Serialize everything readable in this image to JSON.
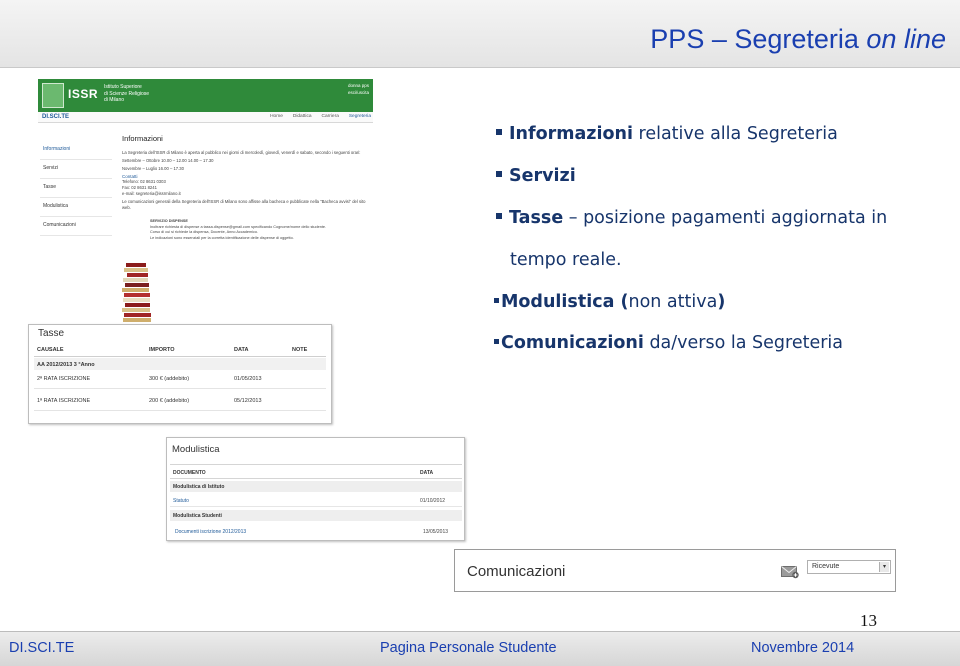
{
  "header": {
    "title_prefix": "PPS – Segreteria ",
    "title_emphasis": "on line"
  },
  "portal": {
    "logo_text": "ISSR",
    "logo_lines": [
      "Istituto Superiore",
      "di Scienze Religiose",
      "di Milano"
    ],
    "user_line1": "donna pps",
    "user_line2": "esci/uscita",
    "brand": "DI.SCI.TE",
    "nav": [
      "Home",
      "Didattica",
      "Carriera",
      "Segreteria"
    ],
    "sidebar": [
      "Informazioni",
      "Servizi",
      "Tasse",
      "Modulistica",
      "Comunicazioni"
    ],
    "main_title": "Informazioni",
    "paragraph": "La Segreteria dell'ISSR di Milano è aperta al pubblico nei giorni di mercoledì, giovedì, venerdì e sabato, secondo i seguenti orari:",
    "hours1": "Settembre – Ottobre 10.00 – 12.00 14.00 – 17.30",
    "hours2": "Novembre – Luglio 16.00 – 17.30",
    "contacts_title": "Contatti",
    "tel": "Telefono: 02 8631 0303",
    "fax": "Fax: 02 8631 8241",
    "email": "e-mail: segreteria@issrmilano.it",
    "notice": "Le comunicazioni generali della Segreteria dell'ISSR di Milano sono affisse alla bacheca e pubblicate nella \"Bacheca avvisi\" del sito web.",
    "service_title": "SERVIZIO DISPENSE",
    "service_text1": "Inoltrare richiesta di dispense a tassa.dispense@gmail.com specificando Cognome/nome dello studente.",
    "service_text2": "Corso di cui si richiede la dispensa, Docente, Anno Accademico.",
    "service_text3": "Le indicazioni sono essenziali per la corretta identificazione delle dispense di oggetto."
  },
  "tasse": {
    "title": "Tasse",
    "columns": [
      "CAUSALE",
      "IMPORTO",
      "DATA",
      "NOTE"
    ],
    "group": "AA 2012/2013 3 °Anno",
    "rows": [
      {
        "causale": "2ª RATA ISCRIZIONE",
        "importo": "300 € (addebito)",
        "data": "01/05/2013"
      },
      {
        "causale": "1ª RATA ISCRIZIONE",
        "importo": "200 € (addebito)",
        "data": "05/12/2013"
      }
    ]
  },
  "modulistica": {
    "title": "Modulistica",
    "columns": [
      "DOCUMENTO",
      "DATA"
    ],
    "groups": [
      {
        "name": "Modulistica di Istituto",
        "doc": "Statuto",
        "date": "01/10/2012"
      },
      {
        "name": "Modulistica Studenti",
        "doc": "Documenti iscrizione 2012/2013",
        "date": "13/05/2013"
      }
    ]
  },
  "comunicazioni": {
    "title": "Comunicazioni",
    "dropdown_value": "Ricevute",
    "dropdown_arrow": "▾"
  },
  "bullets": {
    "b1_bold": "Informazioni",
    "b1_rest": " relative alla Segreteria",
    "b2_bold": "Servizi",
    "b3_bold": "Tasse",
    "b3_rest": " – posizione pagamenti aggiornata in",
    "b3_cont": "tempo reale.",
    "b4_bold": "Modulistica (",
    "b4_mid": "non attiva",
    "b4_end": ")",
    "b5_bold": "Comunicazioni",
    "b5_rest": " da/verso la Segreteria"
  },
  "page_number": "13",
  "footer": {
    "left": "DI.SCI.TE",
    "center": "Pagina Personale Studente",
    "right": "Novembre 2014"
  },
  "colors": {
    "title_blue": "#1a3fb0",
    "bullet_navy": "#17356b",
    "portal_green": "#2f8a3a"
  }
}
